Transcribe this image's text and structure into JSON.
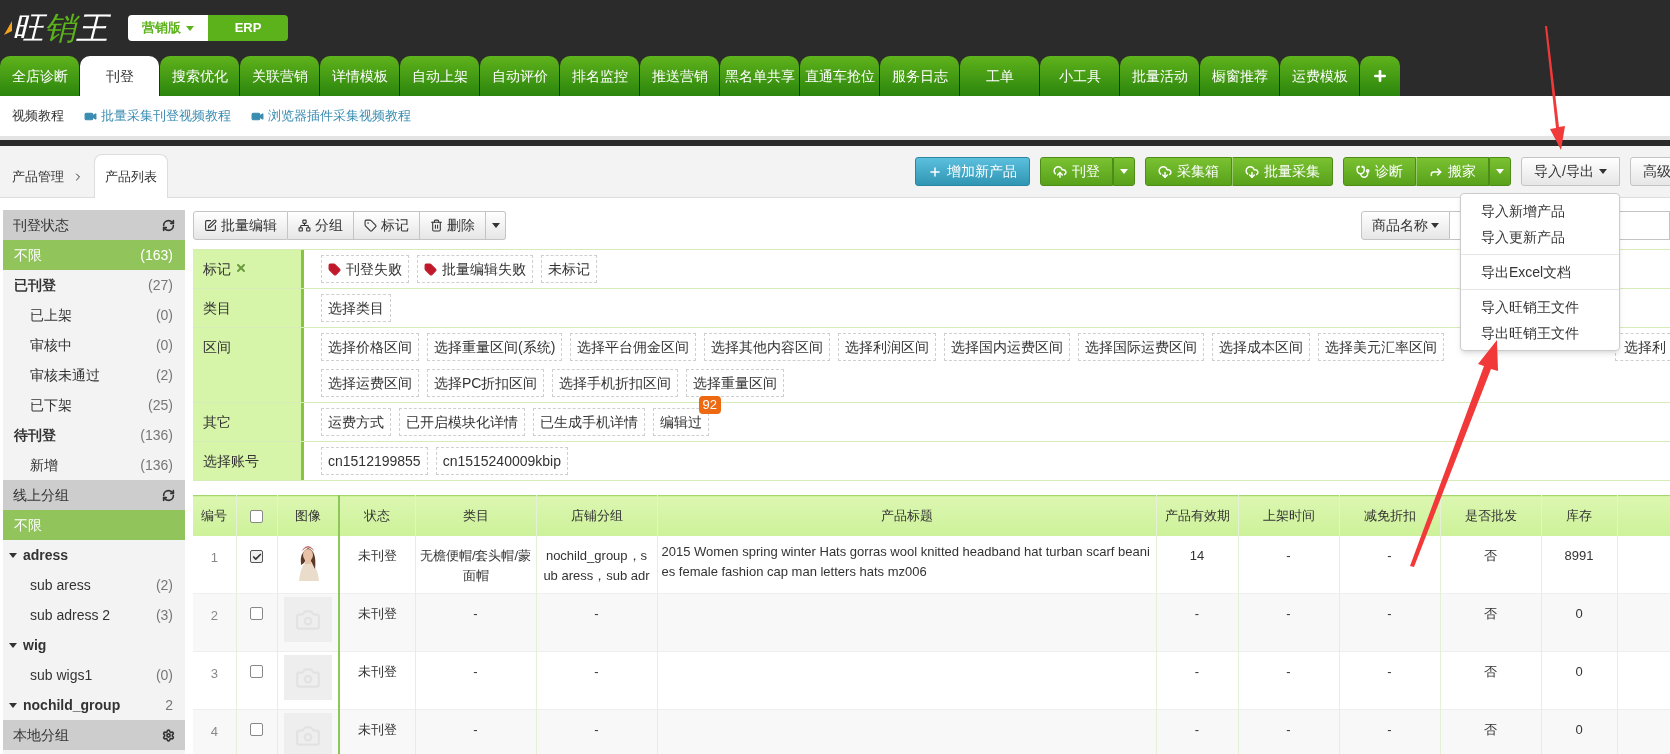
{
  "header": {
    "logo": "旺销王",
    "editions": [
      {
        "label": "营销版",
        "selected": true
      },
      {
        "label": "ERP",
        "selected": false
      }
    ]
  },
  "tabs": [
    {
      "label": "全店诊断",
      "selected": false
    },
    {
      "label": "刊登",
      "selected": true
    },
    {
      "label": "搜索优化",
      "selected": false
    },
    {
      "label": "关联营销",
      "selected": false
    },
    {
      "label": "详情模板",
      "selected": false
    },
    {
      "label": "自动上架",
      "selected": false
    },
    {
      "label": "自动评价",
      "selected": false
    },
    {
      "label": "排名监控",
      "selected": false
    },
    {
      "label": "推送营销",
      "selected": false
    },
    {
      "label": "黑名单共享",
      "selected": false
    },
    {
      "label": "直通车抢位",
      "selected": false
    },
    {
      "label": "服务日志",
      "selected": false
    },
    {
      "label": "工单",
      "selected": false
    },
    {
      "label": "小工具",
      "selected": false
    },
    {
      "label": "批量活动",
      "selected": false
    },
    {
      "label": "橱窗推荐",
      "selected": false
    },
    {
      "label": "运费模板",
      "selected": false
    }
  ],
  "subnav": {
    "label": "视频教程",
    "links": [
      "批量采集刊登视频教程",
      "浏览器插件采集视频教程"
    ]
  },
  "breadcrumb": {
    "parent": "产品管理",
    "current": "产品列表"
  },
  "action_groups": [
    {
      "kind": "primary",
      "caret": false,
      "buttons": [
        {
          "label": "增加新产品",
          "kind": "add"
        }
      ]
    },
    {
      "kind": "success",
      "caret": true,
      "buttons": [
        {
          "label": "刊登",
          "kind": "upload"
        }
      ]
    },
    {
      "kind": "success",
      "caret": false,
      "buttons": [
        {
          "label": "采集箱",
          "kind": "download"
        },
        {
          "label": "批量采集",
          "kind": "download"
        }
      ]
    },
    {
      "kind": "success",
      "caret": true,
      "buttons": [
        {
          "label": "诊断",
          "kind": "diagnose"
        },
        {
          "label": "搬家",
          "kind": "share"
        }
      ]
    },
    {
      "kind": "default",
      "caret": true,
      "buttons": [
        {
          "label": "导入/导出",
          "kind": "text"
        }
      ]
    },
    {
      "kind": "default",
      "caret": false,
      "buttons": [
        {
          "label": "高级",
          "kind": "text"
        }
      ]
    }
  ],
  "menu": [
    [
      "导入新增产品",
      "导入更新产品"
    ],
    [
      "导出Excel文档"
    ],
    [
      "导入旺销王文件",
      "导出旺销王文件"
    ]
  ],
  "sidebar": [
    {
      "title": "刊登状态",
      "kind": "refresh",
      "items": [
        {
          "label": "不限",
          "count": "(163)",
          "selected": true
        },
        {
          "label": "已刊登",
          "count": "(27)",
          "selected": false,
          "children": [
            {
              "label": "已上架",
              "count": "(0)",
              "selected": false
            },
            {
              "label": "审核中",
              "count": "(0)",
              "selected": false
            },
            {
              "label": "审核未通过",
              "count": "(2)",
              "selected": false
            },
            {
              "label": "已下架",
              "count": "(25)",
              "selected": false
            }
          ]
        },
        {
          "label": "待刊登",
          "count": "(136)",
          "selected": false,
          "children": [
            {
              "label": "新增",
              "count": "(136)",
              "selected": false
            }
          ]
        }
      ]
    },
    {
      "title": "线上分组",
      "kind": "refresh",
      "items": [
        {
          "label": "不限",
          "selected": true
        },
        {
          "label": "adress",
          "selected": false,
          "expanded": true,
          "children": [
            {
              "label": "sub aress",
              "count": "(2)",
              "selected": false
            },
            {
              "label": "sub adress 2",
              "count": "(3)",
              "selected": false
            }
          ]
        },
        {
          "label": "wig",
          "selected": false,
          "expanded": true,
          "children": [
            {
              "label": "sub wigs1",
              "count": "(0)",
              "selected": false
            }
          ]
        },
        {
          "label": "nochild_group",
          "count": "2",
          "selected": false,
          "expanded": true
        }
      ]
    },
    {
      "title": "本地分组",
      "kind": "settings"
    }
  ],
  "bulk_toolbar": [
    {
      "label": "批量编辑",
      "kind": "edit"
    },
    {
      "label": "分组",
      "kind": "group"
    },
    {
      "label": "标记",
      "kind": "mark"
    },
    {
      "label": "删除",
      "kind": "delete"
    }
  ],
  "search": {
    "field": "商品名称"
  },
  "filters": [
    {
      "label": "标记",
      "removable": true,
      "lines": [
        [
          {
            "label": "刊登失败",
            "tag": true
          },
          {
            "label": "批量编辑失败",
            "tag": true
          },
          {
            "label": "未标记",
            "tag": false
          }
        ]
      ]
    },
    {
      "label": "类目",
      "lines": [
        [
          {
            "label": "选择类目"
          }
        ]
      ]
    },
    {
      "label": "区间",
      "lines": [
        [
          {
            "label": "选择价格区间"
          },
          {
            "label": "选择重量区间(系统)"
          },
          {
            "label": "选择平台佣金区间"
          },
          {
            "label": "选择其他内容区间"
          },
          {
            "label": "选择利润区间"
          },
          {
            "label": "选择国内运费区间"
          },
          {
            "label": "选择国际运费区间"
          },
          {
            "label": "选择成本区间"
          },
          {
            "label": "选择美元汇率区间"
          },
          {
            "label": "选择利",
            "edge": true
          }
        ],
        [
          {
            "label": "选择运费区间"
          },
          {
            "label": "选择PC折扣区间"
          },
          {
            "label": "选择手机折扣区间"
          },
          {
            "label": "选择重量区间"
          }
        ]
      ]
    },
    {
      "label": "其它",
      "lines": [
        [
          {
            "label": "运费方式"
          },
          {
            "label": "已开启模块化详情"
          },
          {
            "label": "已生成手机详情"
          },
          {
            "label": "编辑过",
            "badge": "92"
          }
        ]
      ]
    },
    {
      "label": "选择账号",
      "lines": [
        [
          {
            "label": "cn1512199855"
          },
          {
            "label": "cn1515240009kbip"
          }
        ]
      ]
    }
  ],
  "table": {
    "header_checked": false,
    "columns": [
      "编号",
      "图像",
      "状态",
      "类目",
      "店铺分组",
      "产品标题",
      "产品有效期",
      "上架时间",
      "减免折扣",
      "是否批发",
      "库存"
    ],
    "rows": [
      {
        "no": "1",
        "checked": true,
        "photo": true,
        "status": "未刊登",
        "category": "无檐便帽/套头帽/蒙面帽",
        "shop_group": "nochild_group，sub aress，sub adr",
        "title": "2015 Women spring winter Hats gorras wool knitted headband hat turban scarf beanies female fashion cap man letters hats mz006",
        "validity": "14",
        "listed": "-",
        "discount": "-",
        "wholesale": "否",
        "stock": "8991"
      },
      {
        "no": "2",
        "checked": false,
        "photo": false,
        "status": "未刊登",
        "category": "-",
        "shop_group": "-",
        "validity": "-",
        "listed": "-",
        "discount": "-",
        "wholesale": "否",
        "stock": "0"
      },
      {
        "no": "3",
        "checked": false,
        "photo": false,
        "status": "未刊登",
        "category": "-",
        "shop_group": "-",
        "validity": "-",
        "listed": "-",
        "discount": "-",
        "wholesale": "否",
        "stock": "0"
      },
      {
        "no": "4",
        "checked": false,
        "photo": false,
        "status": "未刊登",
        "category": "-",
        "shop_group": "-",
        "validity": "-",
        "listed": "-",
        "discount": "-",
        "wholesale": "否",
        "stock": "0"
      }
    ]
  }
}
